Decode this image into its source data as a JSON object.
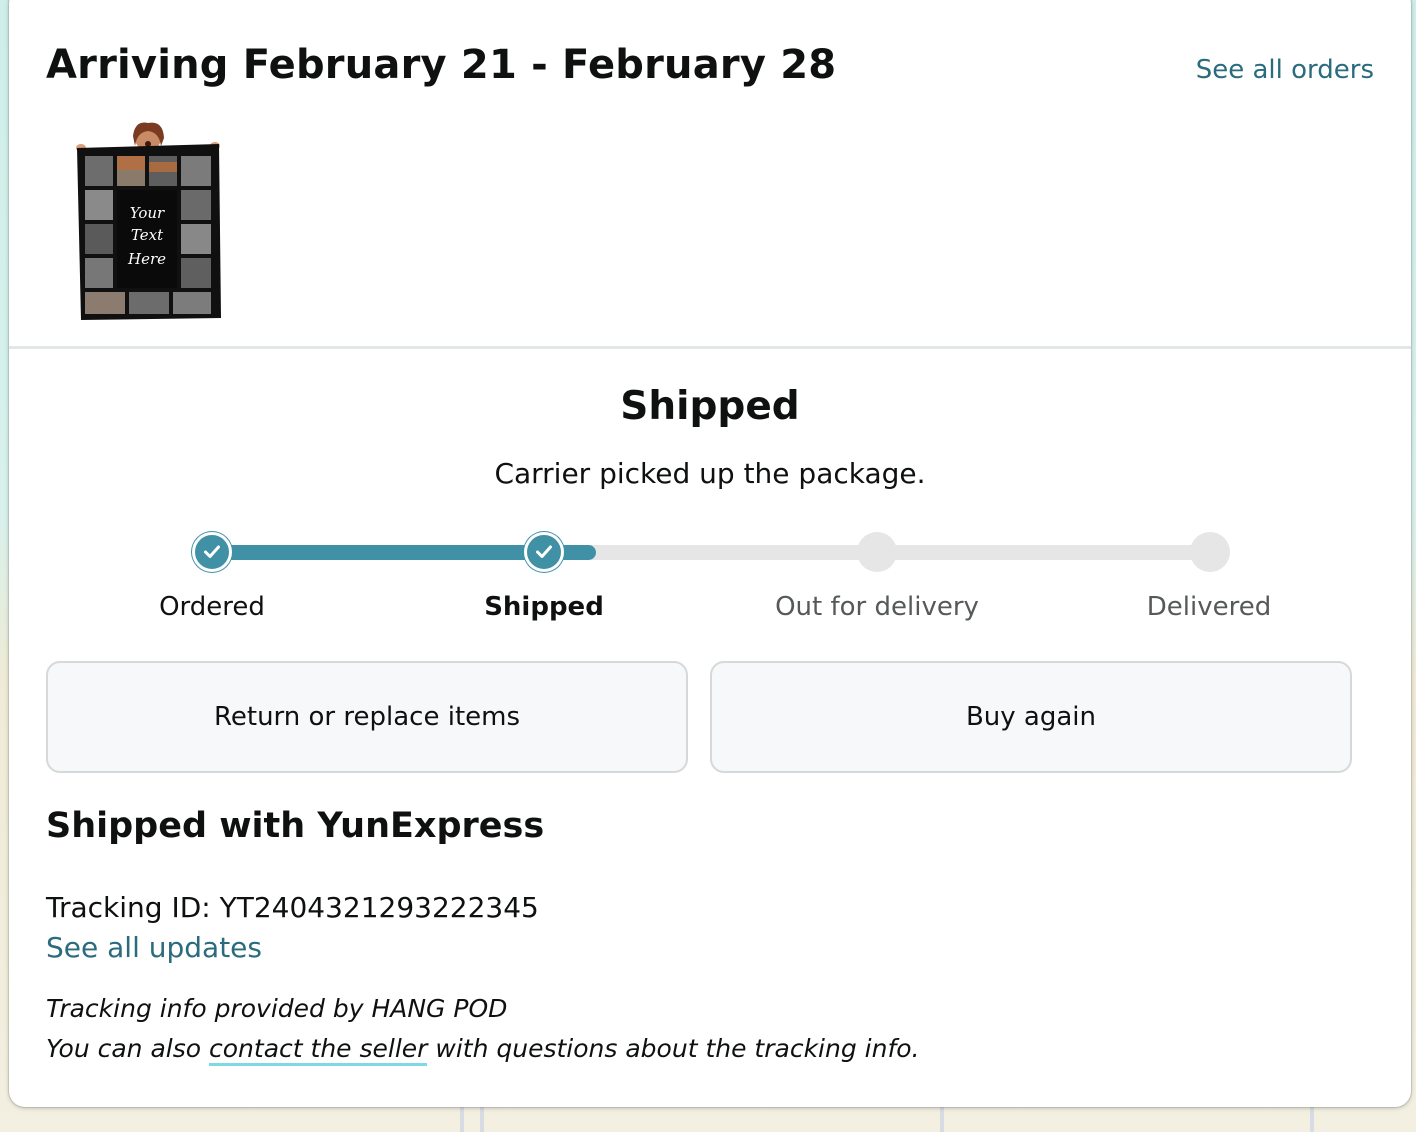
{
  "header": {
    "arriving_title": "Arriving February 21 - February 28",
    "see_all_orders": "See all orders"
  },
  "product": {
    "image_icon": "custom-photo-blanket-image",
    "image_text_line1": "Your",
    "image_text_line2": "Text",
    "image_text_line3": "Here"
  },
  "status": {
    "heading": "Shipped",
    "subtext": "Carrier picked up the package.",
    "progress_fraction": 0.385,
    "steps": [
      {
        "label": "Ordered",
        "state": "done"
      },
      {
        "label": "Shipped",
        "state": "current"
      },
      {
        "label": "Out for delivery",
        "state": "pending"
      },
      {
        "label": "Delivered",
        "state": "pending"
      }
    ]
  },
  "actions": {
    "return_label": "Return or replace items",
    "buy_again_label": "Buy again"
  },
  "shipping": {
    "heading": "Shipped with YunExpress",
    "tracking_id": "Tracking ID: YT2404321293222345",
    "see_updates": "See all updates",
    "note_line1": "Tracking info provided by HANG POD",
    "note_line2_before": "You can also ",
    "note_line2_link": "contact the seller",
    "note_line2_after": " with questions about the tracking info."
  },
  "colors": {
    "accent": "#4191a6",
    "link": "#2a6c7d",
    "track_pending": "#e6e6e6",
    "link_underline": "#7fd8e6"
  }
}
